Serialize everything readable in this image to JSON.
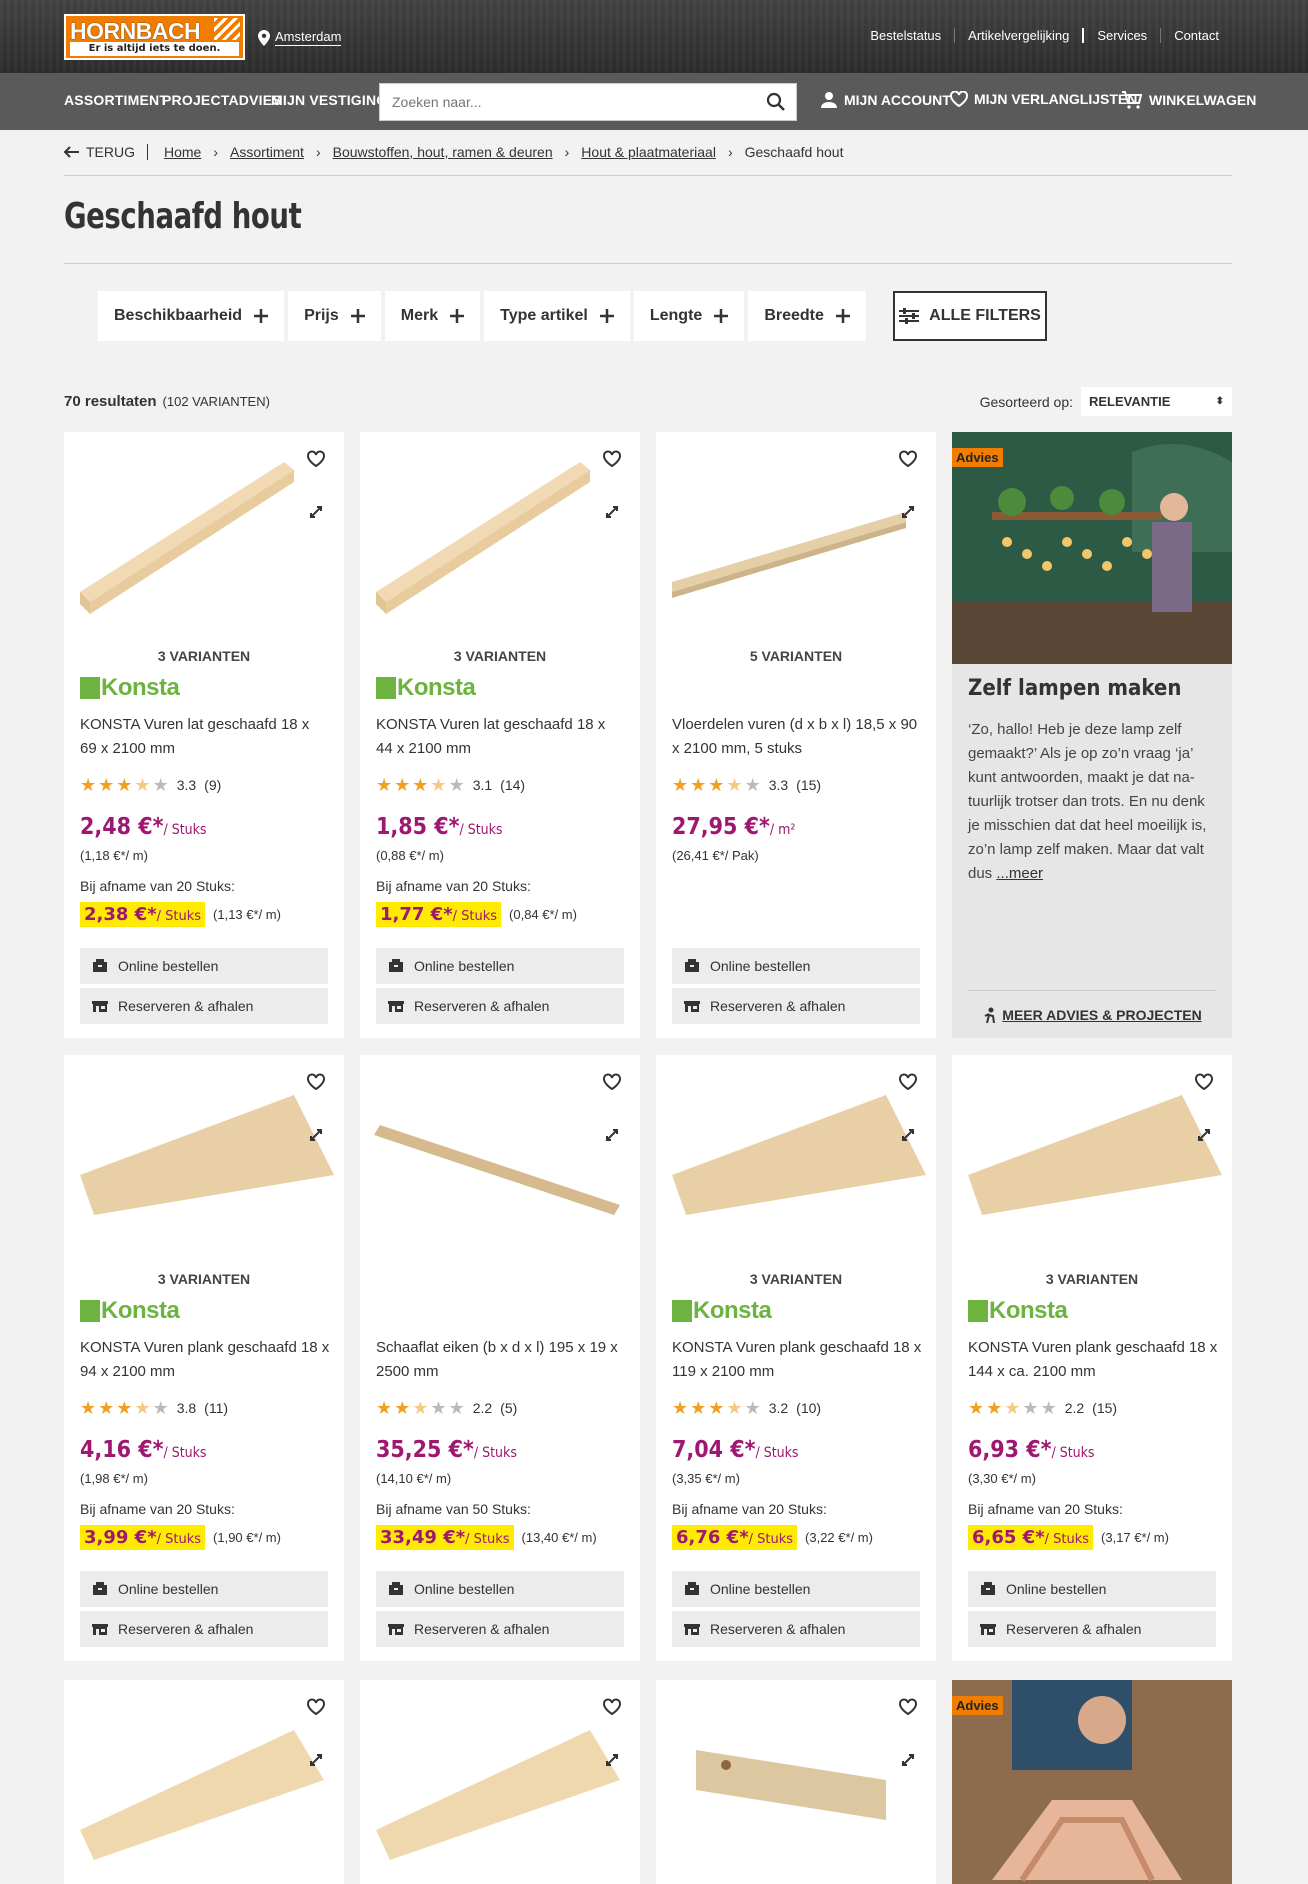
{
  "header": {
    "brand": "HORNBACH",
    "tagline": "Er is altijd iets te doen.",
    "location": "Amsterdam",
    "toplinks": [
      "Bestelstatus",
      "Artikelvergelijking",
      "Services",
      "Contact"
    ]
  },
  "nav": {
    "items": [
      "ASSORTIMENT",
      "PROJECTADVIES",
      "MIJN VESTIGING"
    ],
    "search_placeholder": "Zoeken naar...",
    "account": "MIJN ACCOUNT",
    "wishlists": "MIJN VERLANGLIJSTEN",
    "cart": "WINKELWAGEN"
  },
  "breadcrumb": {
    "back": "TERUG",
    "items": [
      "Home",
      "Assortiment",
      "Bouwstoffen, hout, ramen & deuren",
      "Hout & plaatmateriaal"
    ],
    "current": "Geschaafd hout"
  },
  "page_title": "Geschaafd hout",
  "filters": [
    "Beschikbaarheid",
    "Prijs",
    "Merk",
    "Type artikel",
    "Lengte",
    "Breedte"
  ],
  "all_filters": "ALLE FILTERS",
  "results": {
    "count": "70 resultaten",
    "variants": "(102 VARIANTEN)"
  },
  "sort": {
    "label": "Gesorteerd op:",
    "value": "RELEVANTIE"
  },
  "colors": {
    "price": "#9e1770",
    "accent": "#f07d00",
    "highlight": "#ffeb00",
    "brand_green": "#6db33f"
  },
  "products": [
    {
      "variants": "3 VARIANTEN",
      "brand": "Konsta",
      "name": "KONSTA Vuren lat geschaafd 18 x 69 x 2100 mm",
      "stars": 3.3,
      "rating": "3.3",
      "reviews": "(9)",
      "price": "2,48 €*",
      "unit": "/ Stuks",
      "unit_price": "(1,18 €*/ m)",
      "bulk_label": "Bij afname van 20 Stuks:",
      "bulk_price": "2,38 €*",
      "bulk_unit": "/ Stuks",
      "bulk_unit_price": "(1,13 €*/ m)",
      "online": "Online bestellen",
      "reserve": "Reserveren & afhalen"
    },
    {
      "variants": "3 VARIANTEN",
      "brand": "Konsta",
      "name": "KONSTA Vuren lat geschaafd 18 x 44 x 2100 mm",
      "stars": 3.1,
      "rating": "3.1",
      "reviews": "(14)",
      "price": "1,85 €*",
      "unit": "/ Stuks",
      "unit_price": "(0,88 €*/ m)",
      "bulk_label": "Bij afname van 20 Stuks:",
      "bulk_price": "1,77 €*",
      "bulk_unit": "/ Stuks",
      "bulk_unit_price": "(0,84 €*/ m)",
      "online": "Online bestellen",
      "reserve": "Reserveren & afhalen"
    },
    {
      "variants": "5 VARIANTEN",
      "brand": "",
      "name": "Vloerdelen vuren (d x b x l) 18,5 x 90 x 2100 mm, 5 stuks",
      "stars": 3.3,
      "rating": "3.3",
      "reviews": "(15)",
      "price": "27,95 €*",
      "unit": "/ m²",
      "unit_price": "(26,41 €*/ Pak)",
      "bulk_label": "",
      "bulk_price": "",
      "bulk_unit": "",
      "bulk_unit_price": "",
      "online": "Online bestellen",
      "reserve": "Reserveren & afhalen"
    },
    {
      "variants": "3 VARIANTEN",
      "brand": "Konsta",
      "name": "KONSTA Vuren plank geschaafd 18 x 94 x 2100 mm",
      "stars": 3.8,
      "rating": "3.8",
      "reviews": "(11)",
      "price": "4,16 €*",
      "unit": "/ Stuks",
      "unit_price": "(1,98 €*/ m)",
      "bulk_label": "Bij afname van 20 Stuks:",
      "bulk_price": "3,99 €*",
      "bulk_unit": "/ Stuks",
      "bulk_unit_price": "(1,90 €*/ m)",
      "online": "Online bestellen",
      "reserve": "Reserveren & afhalen"
    },
    {
      "variants": "",
      "brand": "",
      "name": "Schaaflat eiken (b x d x l) 195 x 19 x 2500 mm",
      "stars": 2.2,
      "rating": "2.2",
      "reviews": "(5)",
      "price": "35,25 €*",
      "unit": "/ Stuks",
      "unit_price": "(14,10 €*/ m)",
      "bulk_label": "Bij afname van 50 Stuks:",
      "bulk_price": "33,49 €*",
      "bulk_unit": "/ Stuks",
      "bulk_unit_price": "(13,40 €*/ m)",
      "online": "Online bestellen",
      "reserve": "Reserveren & afhalen"
    },
    {
      "variants": "3 VARIANTEN",
      "brand": "Konsta",
      "name": "KONSTA Vuren plank geschaafd 18 x 119 x 2100 mm",
      "stars": 3.2,
      "rating": "3.2",
      "reviews": "(10)",
      "price": "7,04 €*",
      "unit": "/ Stuks",
      "unit_price": "(3,35 €*/ m)",
      "bulk_label": "Bij afname van 20 Stuks:",
      "bulk_price": "6,76 €*",
      "bulk_unit": "/ Stuks",
      "bulk_unit_price": "(3,22 €*/ m)",
      "online": "Online bestellen",
      "reserve": "Reserveren & afhalen"
    },
    {
      "variants": "3 VARIANTEN",
      "brand": "Konsta",
      "name": "KONSTA Vuren plank geschaafd 18 x 144 x ca. 2100 mm",
      "stars": 2.2,
      "rating": "2.2",
      "reviews": "(15)",
      "price": "6,93 €*",
      "unit": "/ Stuks",
      "unit_price": "(3,30 €*/ m)",
      "bulk_label": "Bij afname van 20 Stuks:",
      "bulk_price": "6,65 €*",
      "bulk_unit": "/ Stuks",
      "bulk_unit_price": "(3,17 €*/ m)",
      "online": "Online bestellen",
      "reserve": "Reserveren & afhalen"
    }
  ],
  "advice": [
    {
      "badge": "Advies",
      "title": "Zelf lampen maken",
      "text": "‘Zo, hallo! Heb je deze lamp zelf gemaakt?’ Als je op zo’n vraag ‘ja’ kunt antwoorden, maakt je dat na-tuurlijk trotser dan trots. En nu denk je misschien dat dat heel moeilijk is, zo’n lamp zelf maken. Maar dat valt dus ",
      "more": "...meer",
      "link": "MEER ADVIES & PROJECTEN"
    },
    {
      "badge": "Advies"
    }
  ]
}
